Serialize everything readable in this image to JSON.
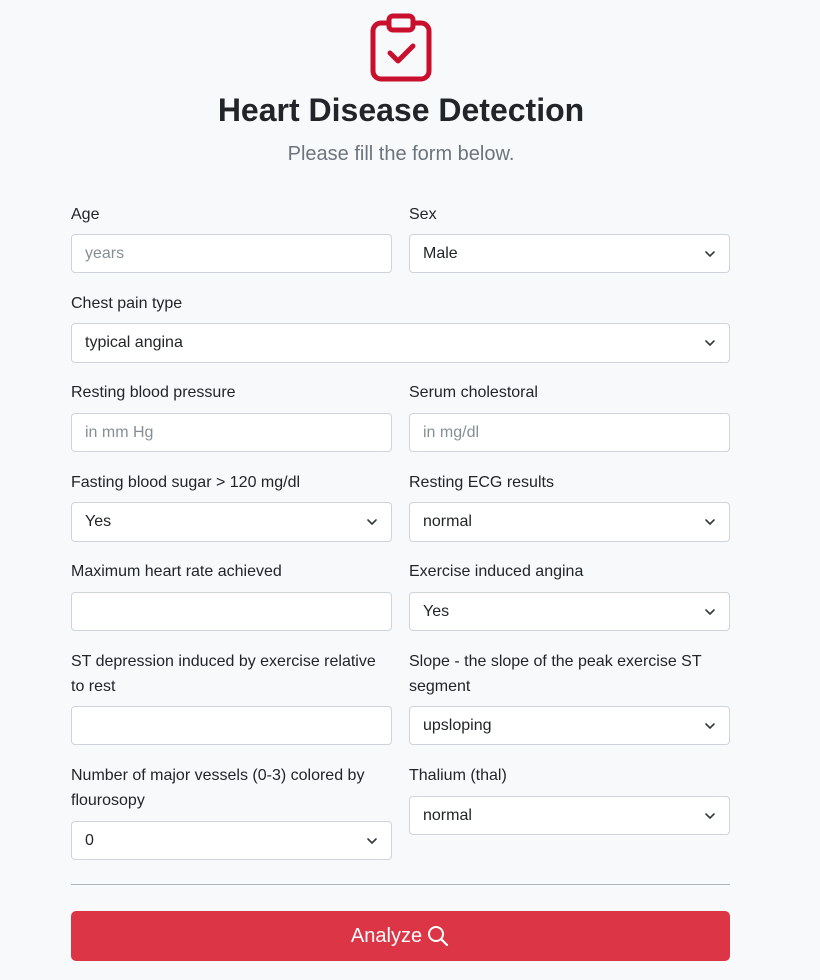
{
  "header": {
    "icon": "clipboard-check-icon",
    "title": "Heart Disease Detection",
    "subtitle": "Please fill the form below."
  },
  "colors": {
    "accent": "#dc3545",
    "icon": "#c8102e",
    "background": "#f8f9fa",
    "border": "#ced4da",
    "placeholder": "#868e96"
  },
  "form": {
    "age": {
      "label": "Age",
      "value": "",
      "placeholder": "years"
    },
    "sex": {
      "label": "Sex",
      "value": "Male"
    },
    "chest_pain": {
      "label": "Chest pain type",
      "value": "typical angina"
    },
    "rest_bp": {
      "label": "Resting blood pressure",
      "value": "",
      "placeholder": "in mm Hg"
    },
    "chol": {
      "label": "Serum cholestoral",
      "value": "",
      "placeholder": "in mg/dl"
    },
    "fbs": {
      "label": "Fasting blood sugar > 120 mg/dl",
      "value": "Yes"
    },
    "restecg": {
      "label": "Resting ECG results",
      "value": "normal"
    },
    "thalach": {
      "label": "Maximum heart rate achieved",
      "value": "",
      "placeholder": ""
    },
    "exang": {
      "label": "Exercise induced angina",
      "value": "Yes"
    },
    "oldpeak": {
      "label": "ST depression induced by exercise relative to rest",
      "value": "",
      "placeholder": ""
    },
    "slope": {
      "label": "Slope - the slope of the peak exercise ST segment",
      "value": "upsloping"
    },
    "ca": {
      "label": "Number of major vessels (0-3) colored by flourosopy",
      "value": "0"
    },
    "thal": {
      "label": "Thalium (thal)",
      "value": "normal"
    }
  },
  "submit": {
    "label": "Analyze",
    "icon": "search-icon"
  }
}
